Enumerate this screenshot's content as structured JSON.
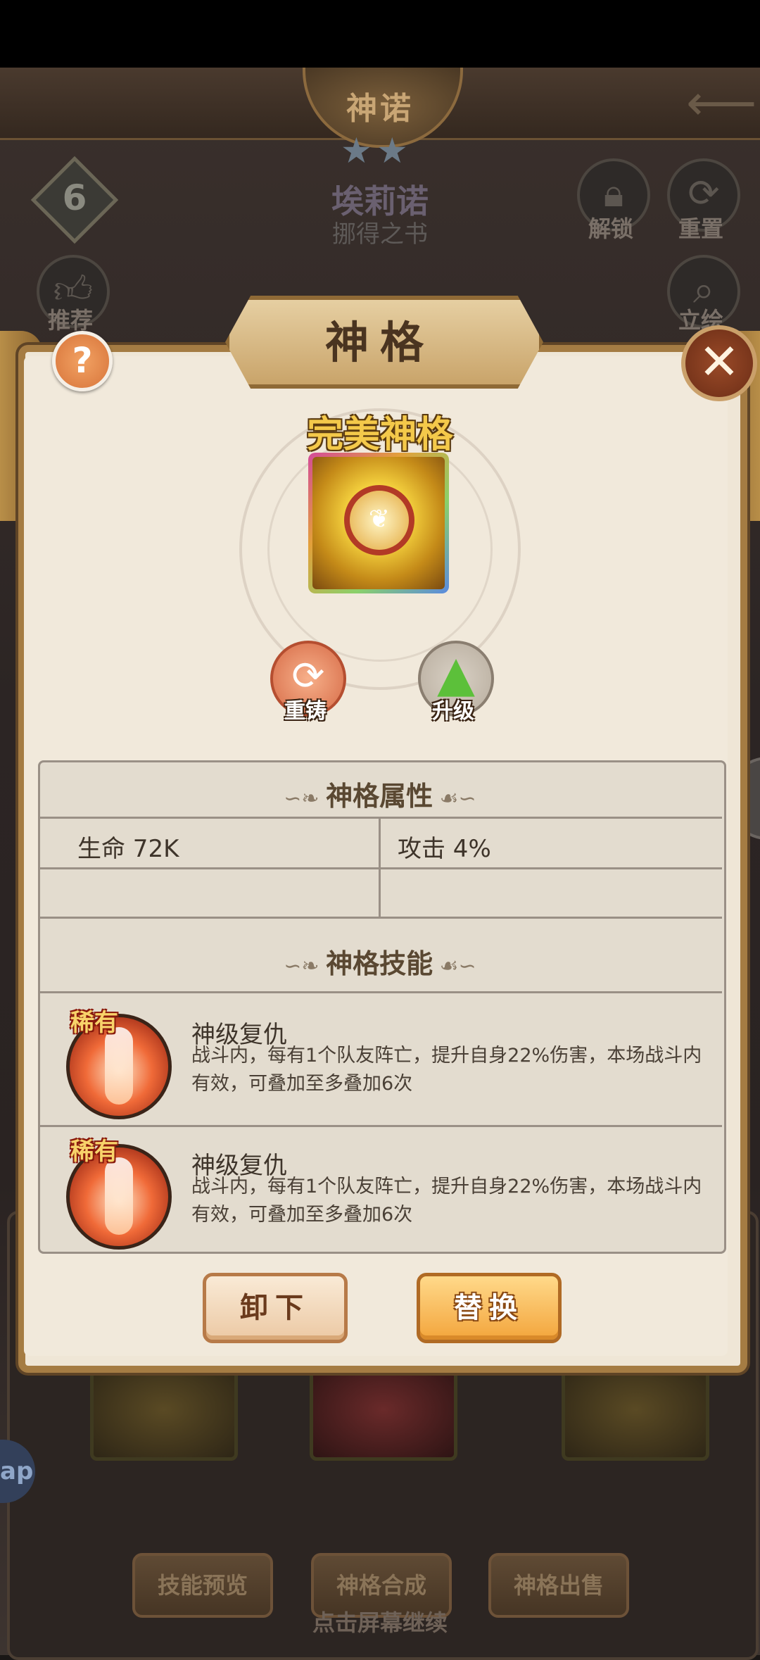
{
  "header": {
    "title": "神诺",
    "stars": "★★",
    "level": "6",
    "hero_name": "埃莉诺",
    "hero_subtitle": "挪得之书",
    "unlock_label": "解锁",
    "reset_label": "重置",
    "recommend_label": "推荐",
    "stand_label": "立绘"
  },
  "dialog": {
    "title": "神格",
    "help": "?",
    "close": "✕",
    "item_name": "完美神格",
    "reforge_label": "重铸",
    "upgrade_label": "升级",
    "attributes": {
      "title": "神格属性",
      "rows": [
        {
          "left": "生命  72K",
          "right": "攻击  4%"
        },
        {
          "left": "",
          "right": ""
        }
      ]
    },
    "skills": {
      "title": "神格技能",
      "items": [
        {
          "rarity": "稀有",
          "name": "神级复仇",
          "desc": "战斗内，每有1个队友阵亡，提升自身22%伤害，本场战斗内有效，可叠加至多叠加6次"
        },
        {
          "rarity": "稀有",
          "name": "神级复仇",
          "desc": "战斗内，每有1个队友阵亡，提升自身22%伤害，本场战斗内有效，可叠加至多叠加6次"
        }
      ]
    },
    "unload_button": "卸下",
    "replace_button": "替换"
  },
  "background_buttons": {
    "skill_preview": "技能预览",
    "compose": "神格合成",
    "sell": "神格出售"
  },
  "side_tab": "ap",
  "continue_hint": "点击屏幕继续",
  "colors": {
    "gold_title": "#f4c94a",
    "dialog_border": "#a57c43",
    "replace_button": "#f3a53c"
  }
}
